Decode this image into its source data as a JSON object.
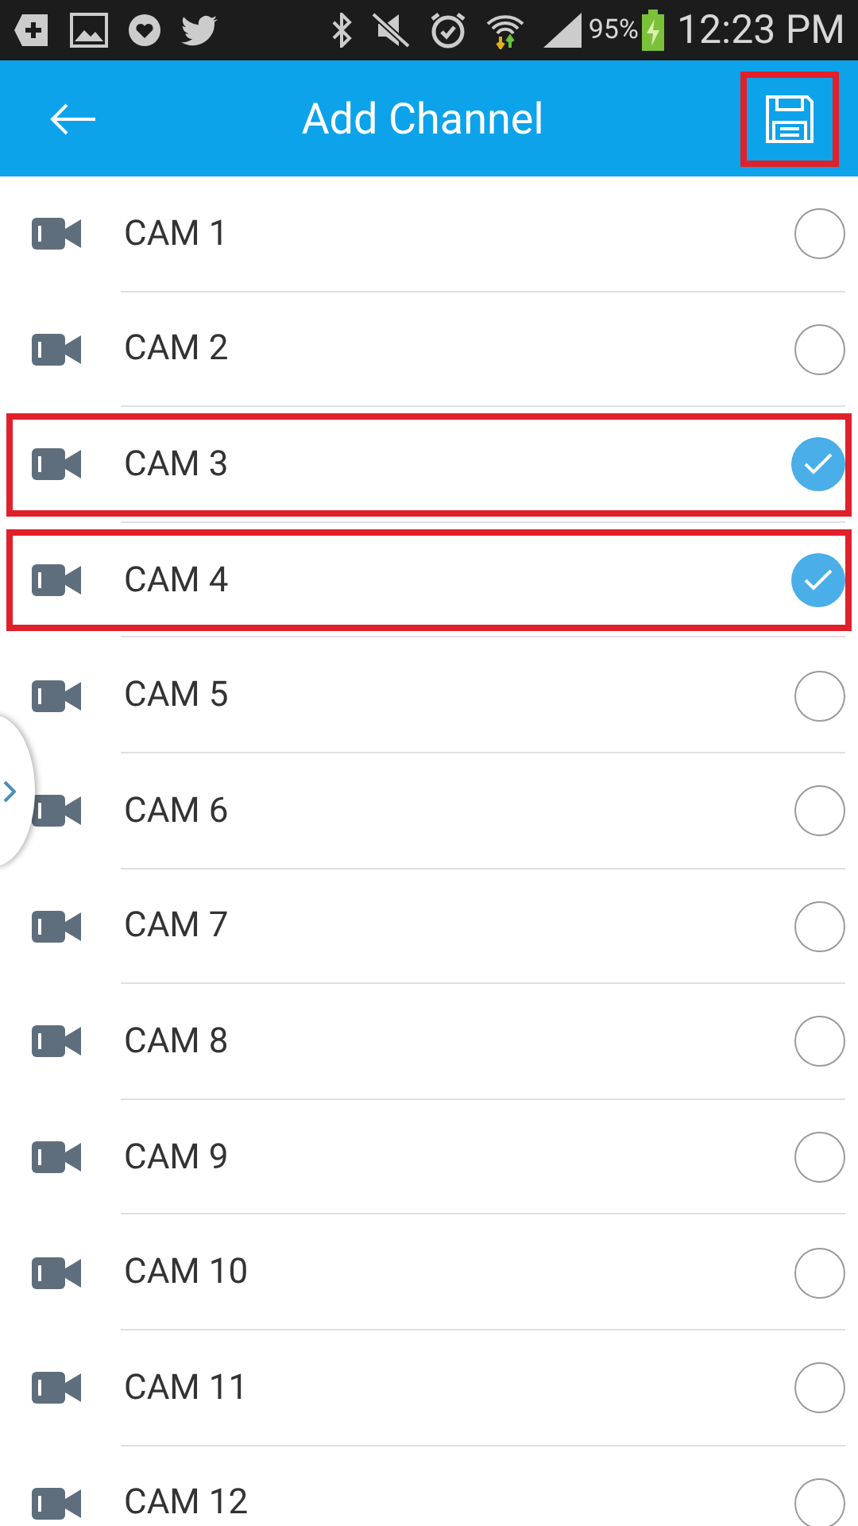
{
  "status_bar": {
    "battery": "95%",
    "time": "12:23 PM"
  },
  "header": {
    "title": "Add Channel",
    "save_highlighted": true
  },
  "channels": [
    {
      "name": "CAM 1",
      "checked": false,
      "highlighted": false
    },
    {
      "name": "CAM 2",
      "checked": false,
      "highlighted": false
    },
    {
      "name": "CAM 3",
      "checked": true,
      "highlighted": true
    },
    {
      "name": "CAM 4",
      "checked": true,
      "highlighted": true
    },
    {
      "name": "CAM 5",
      "checked": false,
      "highlighted": false
    },
    {
      "name": "CAM 6",
      "checked": false,
      "highlighted": false
    },
    {
      "name": "CAM 7",
      "checked": false,
      "highlighted": false
    },
    {
      "name": "CAM 8",
      "checked": false,
      "highlighted": false
    },
    {
      "name": "CAM 9",
      "checked": false,
      "highlighted": false
    },
    {
      "name": "CAM 10",
      "checked": false,
      "highlighted": false
    },
    {
      "name": "CAM 11",
      "checked": false,
      "highlighted": false
    },
    {
      "name": "CAM 12",
      "checked": false,
      "highlighted": false
    }
  ]
}
